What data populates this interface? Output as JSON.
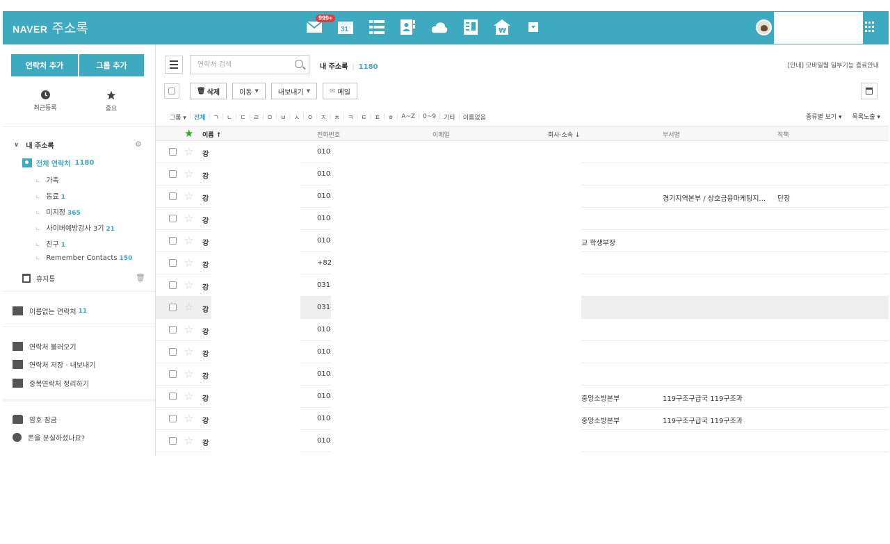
{
  "header": {
    "brand": "NAVER",
    "app_title": "주소록",
    "mail_badge": "999+",
    "calendar_day": "31",
    "apps": [
      "mail-icon",
      "calendar-icon",
      "memo-icon",
      "contacts-icon",
      "cloud-icon",
      "office-icon",
      "pay-icon",
      "more-icon"
    ]
  },
  "sidebar": {
    "add_contact": "연락처 추가",
    "add_group": "그룹 추가",
    "recent": "최근등록",
    "important": "중요",
    "my_book": "내 주소록",
    "all_contacts": "전체 연락처",
    "all_count": "1180",
    "groups": [
      {
        "name": "가족",
        "count": ""
      },
      {
        "name": "동료",
        "count": "1"
      },
      {
        "name": "미지정",
        "count": "365"
      },
      {
        "name": "사이버예방강사 3기",
        "count": "21"
      },
      {
        "name": "친구",
        "count": "1"
      },
      {
        "name": "Remember Contacts",
        "count": "150"
      }
    ],
    "trash": "휴지통",
    "unnamed": "이름없는 연락처",
    "unnamed_count": "11",
    "import": "연락처 불러오기",
    "export": "연락처 저장 · 내보내기",
    "dedupe": "중복연락처 정리하기",
    "lock": "암호 잠금",
    "lost_phone": "폰을 분실하셨나요?"
  },
  "toolbar": {
    "search_placeholder": "연락처 검색",
    "book_title": "내 주소록",
    "book_count": "1180",
    "notice": "[안내] 모바일웹 일부기능 종료안내",
    "delete": "삭제",
    "move": "이동",
    "export": "내보내기",
    "mail": "메일"
  },
  "index_bar": {
    "group": "그룹",
    "items": [
      "전체",
      "ㄱ",
      "ㄴ",
      "ㄷ",
      "ㄹ",
      "ㅁ",
      "ㅂ",
      "ㅅ",
      "ㅇ",
      "ㅈ",
      "ㅊ",
      "ㅋ",
      "ㅌ",
      "ㅍ",
      "ㅎ",
      "A~Z",
      "0~9",
      "기타",
      "이름없음"
    ],
    "view_type": "종류별 보기",
    "list_view": "목록노출"
  },
  "table": {
    "headers": {
      "name": "이름 ↑",
      "phone": "전화번호",
      "email": "이메일",
      "company": "회사·소속 ↓",
      "dept": "부서명",
      "position": "직책"
    },
    "rows": [
      {
        "name": "강",
        "phone": "010-",
        "company": "",
        "dept": "",
        "position": ""
      },
      {
        "name": "강",
        "phone": "010-",
        "company": "",
        "dept": "",
        "position": ""
      },
      {
        "name": "강",
        "phone": "010-",
        "company": "",
        "dept": "경기지역본부 / 상호금융마케팅지...",
        "position": "단장"
      },
      {
        "name": "강",
        "phone": "010-",
        "company": "",
        "dept": "",
        "position": ""
      },
      {
        "name": "강",
        "phone": "010-",
        "company": "교 학생부장",
        "dept": "",
        "position": ""
      },
      {
        "name": "강",
        "phone": "+82",
        "company": "",
        "dept": "",
        "position": ""
      },
      {
        "name": "강",
        "phone": "031-",
        "company": "",
        "dept": "",
        "position": ""
      },
      {
        "name": "강",
        "phone": "031-",
        "company": "",
        "dept": "",
        "position": ""
      },
      {
        "name": "강",
        "phone": "010-",
        "company": "",
        "dept": "",
        "position": ""
      },
      {
        "name": "강",
        "phone": "010-",
        "company": "",
        "dept": "",
        "position": ""
      },
      {
        "name": "강",
        "phone": "010-",
        "company": "",
        "dept": "",
        "position": ""
      },
      {
        "name": "강",
        "phone": "010-",
        "company": "중앙소방본부",
        "dept": "119구조구급국 119구조과",
        "position": ""
      },
      {
        "name": "강",
        "phone": "010-",
        "company": "중앙소방본부",
        "dept": "119구조구급국 119구조과",
        "position": ""
      },
      {
        "name": "강",
        "phone": "010-",
        "company": "",
        "dept": "",
        "position": ""
      }
    ]
  },
  "colors": {
    "accent": "#3eaabf",
    "star_green": "#2fa82f",
    "badge_red": "#e5393d"
  }
}
